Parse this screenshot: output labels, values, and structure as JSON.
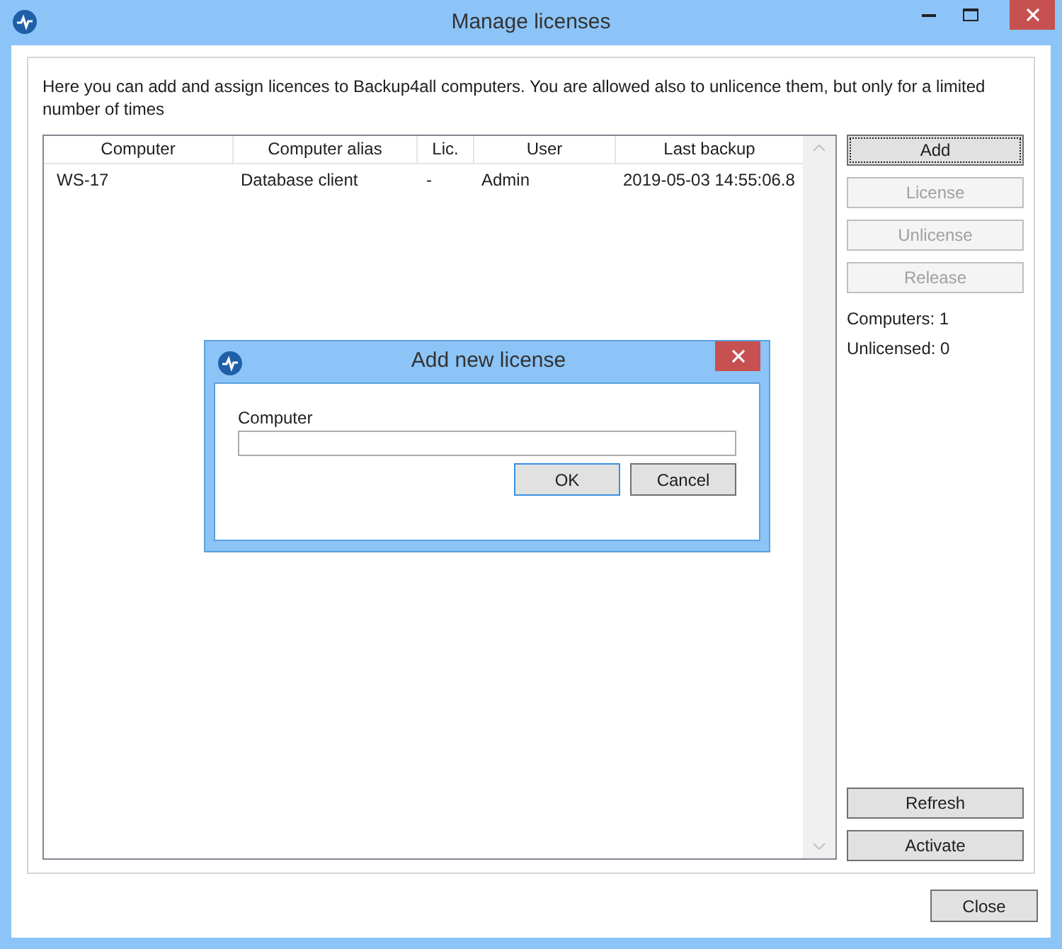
{
  "window": {
    "title": "Manage licenses"
  },
  "description": "Here you can add and assign licences to Backup4all computers. You are allowed also to unlicence them, but only for a limited number of times",
  "table": {
    "columns": [
      "Computer",
      "Computer alias",
      "Lic.",
      "User",
      "Last backup"
    ],
    "rows": [
      {
        "cells": [
          "WS-17",
          "Database client",
          "-",
          "Admin",
          "2019-05-03 14:55:06.8"
        ],
        "selected": false
      }
    ]
  },
  "side_buttons": [
    {
      "label": "Add",
      "disabled": false,
      "focused": true
    },
    {
      "label": "License",
      "disabled": true,
      "focused": false
    },
    {
      "label": "Unlicense",
      "disabled": true,
      "focused": false
    },
    {
      "label": "Release",
      "disabled": true,
      "focused": false
    }
  ],
  "stats": [
    "Computers: 1",
    "Unlicensed: 0"
  ],
  "bottom_buttons": [
    {
      "label": "Refresh",
      "disabled": false,
      "focused": false
    },
    {
      "label": "Activate",
      "disabled": false,
      "focused": false
    }
  ],
  "close_button": {
    "label": "Close"
  },
  "dialog": {
    "title": "Add new license",
    "field_label": "Computer",
    "buttons": [
      {
        "label": "OK",
        "focused": true
      },
      {
        "label": "Cancel",
        "focused": false
      }
    ]
  }
}
